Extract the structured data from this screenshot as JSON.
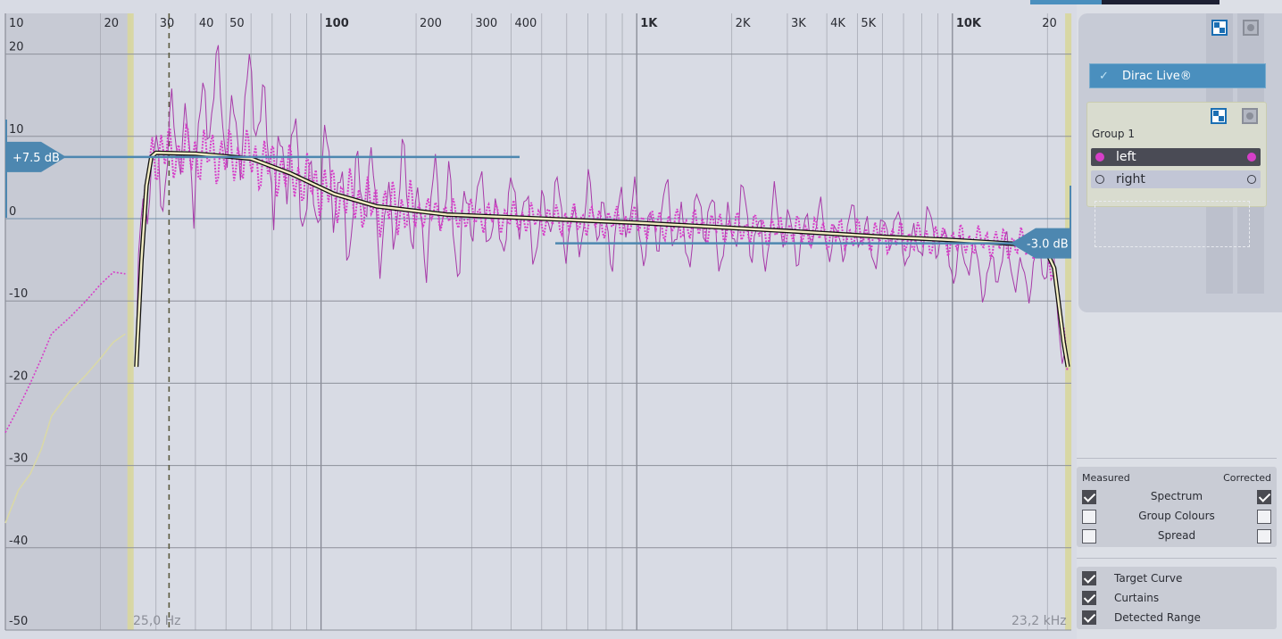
{
  "plot": {
    "x_ticks": [
      {
        "label": "10",
        "freq": 10,
        "major": false
      },
      {
        "label": "20",
        "freq": 20,
        "major": false
      },
      {
        "label": "30",
        "freq": 30,
        "major": false
      },
      {
        "label": "40",
        "freq": 40,
        "major": false
      },
      {
        "label": "50",
        "freq": 50,
        "major": false
      },
      {
        "label": "100",
        "freq": 100,
        "major": true
      },
      {
        "label": "200",
        "freq": 200,
        "major": false
      },
      {
        "label": "300",
        "freq": 300,
        "major": false
      },
      {
        "label": "400",
        "freq": 400,
        "major": false
      },
      {
        "label": "1K",
        "freq": 1000,
        "major": true
      },
      {
        "label": "2K",
        "freq": 2000,
        "major": false
      },
      {
        "label": "3K",
        "freq": 3000,
        "major": false
      },
      {
        "label": "4K",
        "freq": 4000,
        "major": false
      },
      {
        "label": "5K",
        "freq": 5000,
        "major": false
      },
      {
        "label": "10K",
        "freq": 10000,
        "major": true
      },
      {
        "label": "20",
        "freq": 20000,
        "major": false
      }
    ],
    "y_ticks": [
      "20",
      "10",
      "0",
      "-10",
      "-20",
      "-30",
      "-40",
      "-50"
    ],
    "y_tick_values": [
      20,
      10,
      0,
      -10,
      -20,
      -30,
      -40,
      -50
    ],
    "left_curtain_label": "25,0 Hz",
    "right_curtain_label": "23,2 kHz",
    "left_curtain_hz": 25.0,
    "right_curtain_hz": 23200,
    "high_handle_label": "+7.5 dB",
    "high_handle_db": 7.5,
    "low_handle_label": "-3.0 dB",
    "low_handle_db": -3.0,
    "dashed_marker_hz": 33,
    "colors": {
      "measured": "#a73aa8",
      "corrected": "#d63fc8",
      "target": "#f4efc4",
      "handle": "#4d87b0",
      "curtain": "#d8d69c",
      "grid": "#8a8c96"
    },
    "target_curve": [
      [
        26,
        -18
      ],
      [
        27,
        -5
      ],
      [
        28,
        4
      ],
      [
        29,
        7.5
      ],
      [
        30,
        8
      ],
      [
        40,
        7.9
      ],
      [
        60,
        7.3
      ],
      [
        80,
        5.5
      ],
      [
        110,
        3
      ],
      [
        150,
        1.5
      ],
      [
        250,
        0.5
      ],
      [
        500,
        0
      ],
      [
        1000,
        -0.5
      ],
      [
        3000,
        -1.5
      ],
      [
        6000,
        -2.2
      ],
      [
        10000,
        -2.6
      ],
      [
        15000,
        -3
      ],
      [
        19500,
        -3.3
      ],
      [
        21000,
        -6
      ],
      [
        22500,
        -15
      ],
      [
        23200,
        -18
      ]
    ],
    "left_edge_corrected": [
      [
        10,
        -26
      ],
      [
        11,
        -23
      ],
      [
        12,
        -20
      ],
      [
        13,
        -17
      ],
      [
        14,
        -14
      ],
      [
        16,
        -12
      ],
      [
        18,
        -10
      ],
      [
        20,
        -8
      ],
      [
        22,
        -6.5
      ],
      [
        24,
        -6.7
      ]
    ],
    "left_edge_measured": [
      [
        10,
        -37
      ],
      [
        11,
        -33
      ],
      [
        12,
        -31
      ],
      [
        13,
        -28
      ],
      [
        14,
        -24
      ],
      [
        16,
        -21
      ],
      [
        18,
        -19
      ],
      [
        20,
        -17
      ],
      [
        22,
        -15
      ],
      [
        24,
        -14
      ]
    ]
  },
  "side": {
    "dirac_label": "Dirac Live®",
    "group_title": "Group 1",
    "channels": [
      {
        "name": "left"
      },
      {
        "name": "right"
      }
    ],
    "view": {
      "measured_header": "Measured",
      "corrected_header": "Corrected",
      "options": [
        {
          "label": "Spectrum",
          "measured": true,
          "corrected": true
        },
        {
          "label": "Group Colours",
          "measured": false,
          "corrected": false
        },
        {
          "label": "Spread",
          "measured": false,
          "corrected": false
        }
      ]
    },
    "toggles": [
      {
        "label": "Target Curve",
        "checked": true
      },
      {
        "label": "Curtains",
        "checked": true
      },
      {
        "label": "Detected Range",
        "checked": true
      }
    ],
    "tab_colors": [
      "#4a8fbe",
      "#1d2033"
    ]
  }
}
